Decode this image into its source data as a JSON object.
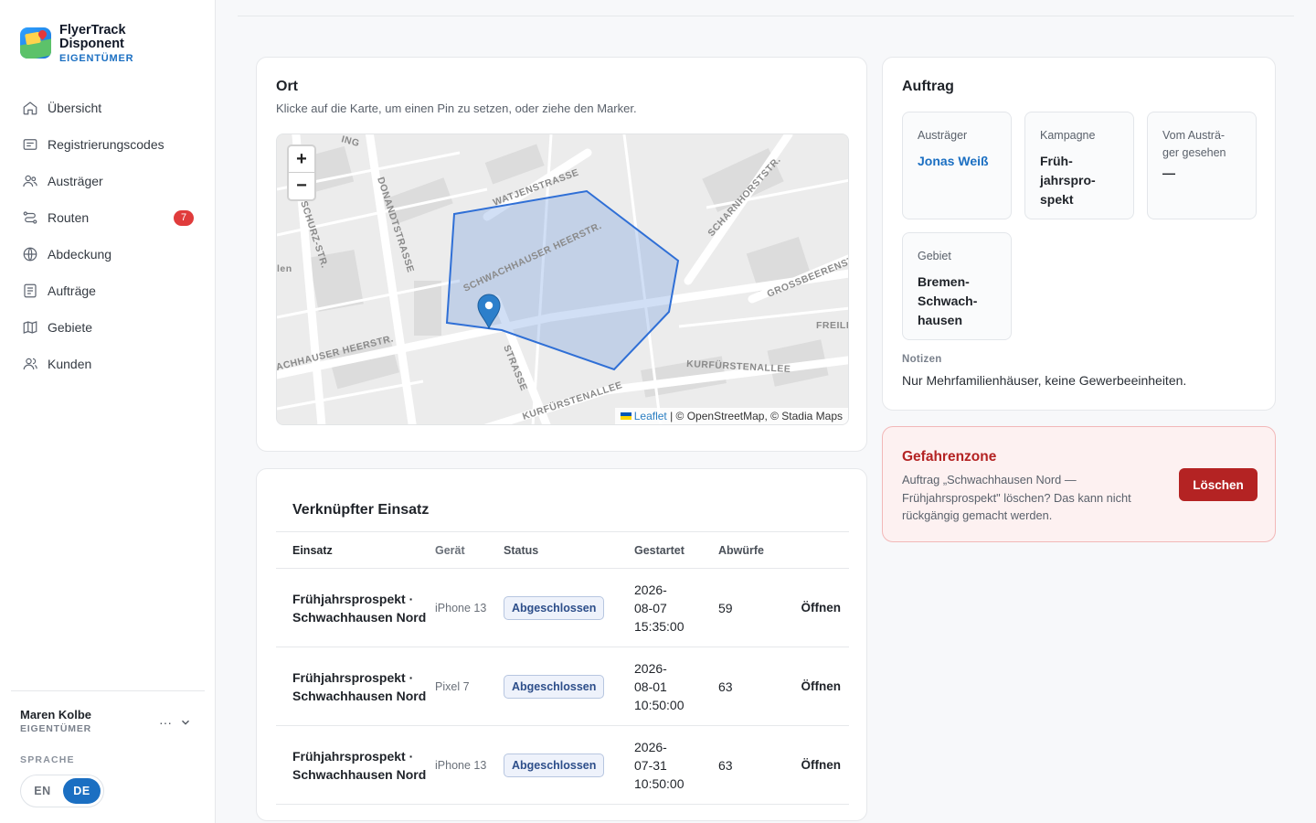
{
  "brand": {
    "name_line1": "FlyerTrack",
    "name_line2": "Disponent",
    "role": "EIGENTÜMER"
  },
  "sidebar": {
    "items": [
      {
        "label": "Übersicht",
        "icon": "home-icon"
      },
      {
        "label": "Registrierungscodes",
        "icon": "code-card-icon"
      },
      {
        "label": "Austräger",
        "icon": "users-icon"
      },
      {
        "label": "Routen",
        "icon": "route-icon",
        "badge": "7"
      },
      {
        "label": "Abdeckung",
        "icon": "globe-icon"
      },
      {
        "label": "Aufträge",
        "icon": "document-icon"
      },
      {
        "label": "Gebiete",
        "icon": "map-icon"
      },
      {
        "label": "Kunden",
        "icon": "customers-icon"
      }
    ],
    "user": {
      "name": "Maren Kolbe",
      "role": "EIGENTÜMER",
      "more": "···"
    },
    "language": {
      "label": "SPRACHE",
      "options": [
        "EN",
        "DE"
      ],
      "selected": "DE"
    }
  },
  "ort": {
    "title": "Ort",
    "hint": "Klicke auf die Karte, um einen Pin zu setzen, oder ziehe den Marker.",
    "zoom_in": "+",
    "zoom_out": "−",
    "attribution_link": "Leaflet",
    "attribution_text": " | © OpenStreetMap, © Stadia Maps",
    "streets": [
      "WATJENSTRASSE",
      "SCHARNHORSTSTR.",
      "SCHWACHHAUSER HEERSTR.",
      "DONANDTSTRASSE",
      "SCHURZ-STR.",
      "GROSSBEERENSTR.",
      "FREILIG",
      "ACHHAUSER HEERSTR.",
      "KURFÜRSTENALLEE",
      "KURFÜRSTENALLEE",
      "STRASSE",
      "len",
      "ING"
    ]
  },
  "auftrag": {
    "title": "Auftrag",
    "tiles": [
      {
        "label": "Austräger",
        "value": "Jonas Weiß"
      },
      {
        "label": "Kampagne",
        "value": "Früh-\njahrspro-\nspekt"
      },
      {
        "label": "Vom Austrä-\nger gesehen",
        "value": "—"
      },
      {
        "label": "Gebiet",
        "value": "Bremen-\nSchwach-\nhausen"
      }
    ],
    "notes_label": "Notizen",
    "notes": "Nur Mehrfamilienhäuser, keine Gewerbeeinheiten."
  },
  "danger": {
    "title": "Gefahrenzone",
    "text": "Auftrag „Schwachhausen Nord — Frühjahrsprospekt\" löschen? Das kann nicht rückgängig gemacht werden.",
    "button": "Löschen"
  },
  "einsatz": {
    "title": "Verknüpfter Einsatz",
    "columns": [
      "Einsatz",
      "Gerät",
      "Status",
      "Gestartet",
      "Abwürfe",
      ""
    ],
    "rows": [
      {
        "name": "Frühjahrsprospekt · Schwachhausen Nord",
        "device": "iPhone 13",
        "status": "Abgeschlossen",
        "started_date": "2026-\n08-07",
        "started_time": "15:35:00",
        "drops": "59",
        "action": "Öffnen"
      },
      {
        "name": "Frühjahrsprospekt · Schwachhausen Nord",
        "device": "Pixel 7",
        "status": "Abgeschlossen",
        "started_date": "2026-\n08-01",
        "started_time": "10:50:00",
        "drops": "63",
        "action": "Öffnen"
      },
      {
        "name": "Frühjahrsprospekt · Schwachhausen Nord",
        "device": "iPhone 13",
        "status": "Abgeschlossen",
        "started_date": "2026-\n07-31",
        "started_time": "10:50:00",
        "drops": "63",
        "action": "Öffnen"
      }
    ]
  }
}
